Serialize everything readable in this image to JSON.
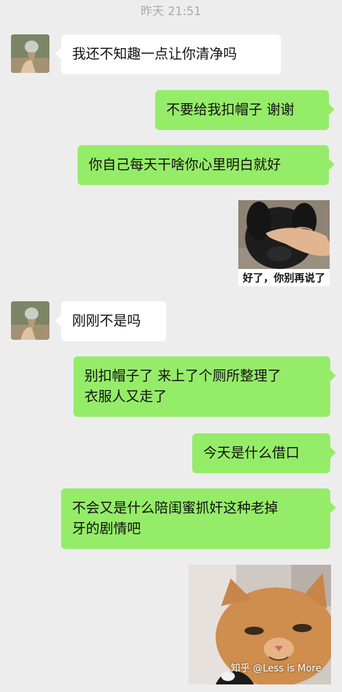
{
  "timestamp": "昨天 21:51",
  "messages": [
    {
      "text": "我还不知趣一点让你清净吗"
    },
    {
      "text": "不要给我扣帽子 谢谢"
    },
    {
      "text": "你自己每天干啥你心里明白就好"
    },
    {
      "sticker_caption": "好了，你别再说了"
    },
    {
      "text": "刚刚不是吗"
    },
    {
      "text": "别扣帽子了 来上了个厕所整理了\n衣服人又走了"
    },
    {
      "text": "今天是什么借口"
    },
    {
      "text": "不会又是什么陪闺蜜抓奸这种老掉\n牙的剧情吧"
    }
  ],
  "watermark": "知乎 @Less is More",
  "colors": {
    "incoming": "#ffffff",
    "outgoing": "#95ec69",
    "background": "#ededed"
  }
}
